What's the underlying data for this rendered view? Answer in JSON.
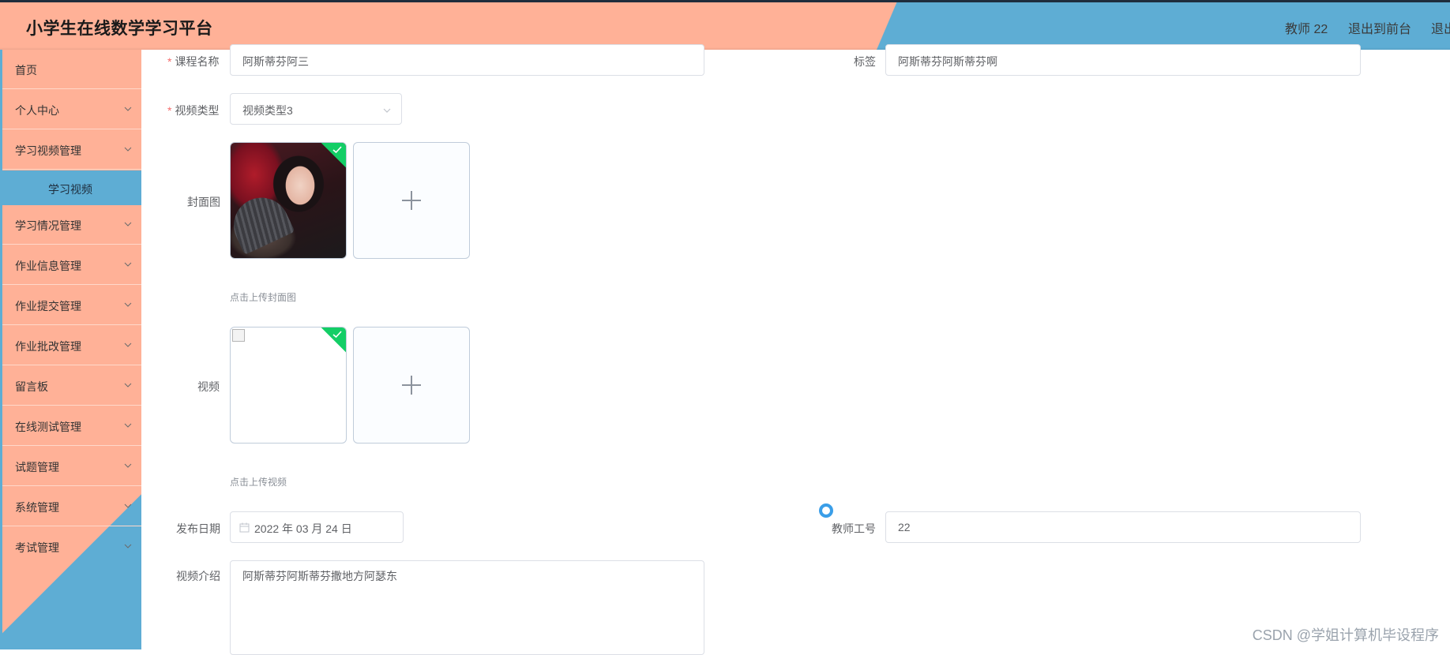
{
  "header": {
    "title": "小学生在线数学学习平台",
    "user": "教师 22",
    "exit_front": "退出到前台",
    "exit_partial": "退出"
  },
  "sidebar": {
    "items": [
      {
        "label": "首页",
        "expandable": false
      },
      {
        "label": "个人中心",
        "expandable": true
      },
      {
        "label": "学习视频管理",
        "expandable": true
      },
      {
        "label": "学习情况管理",
        "expandable": true
      },
      {
        "label": "作业信息管理",
        "expandable": true
      },
      {
        "label": "作业提交管理",
        "expandable": true
      },
      {
        "label": "作业批改管理",
        "expandable": true
      },
      {
        "label": "留言板",
        "expandable": true
      },
      {
        "label": "在线测试管理",
        "expandable": true
      },
      {
        "label": "试题管理",
        "expandable": true
      },
      {
        "label": "系统管理",
        "expandable": true
      },
      {
        "label": "考试管理",
        "expandable": true
      }
    ],
    "submenu": {
      "parent": "学习视频管理",
      "label": "学习视频",
      "active": true
    }
  },
  "form": {
    "course_name": {
      "label": "课程名称",
      "required": true,
      "value": "阿斯蒂芬阿三"
    },
    "tag": {
      "label": "标签",
      "value": "阿斯蒂芬阿斯蒂芬啊"
    },
    "video_type": {
      "label": "视频类型",
      "required": true,
      "value": "视频类型3"
    },
    "cover": {
      "label": "封面图",
      "tip": "点击上传封面图"
    },
    "video": {
      "label": "视频",
      "tip": "点击上传视频"
    },
    "publish_date": {
      "label": "发布日期",
      "value": "2022 年 03 月 24 日"
    },
    "teacher_id": {
      "label": "教师工号",
      "value": "22"
    },
    "intro": {
      "label": "视频介绍",
      "value": "阿斯蒂芬阿斯蒂芬撒地方阿瑟东"
    }
  },
  "watermark": "CSDN @学姐计算机毕设程序",
  "colors": {
    "salmon": "#ffb197",
    "blue": "#5eadd4",
    "success": "#13ce66",
    "required": "#f56c6c"
  }
}
